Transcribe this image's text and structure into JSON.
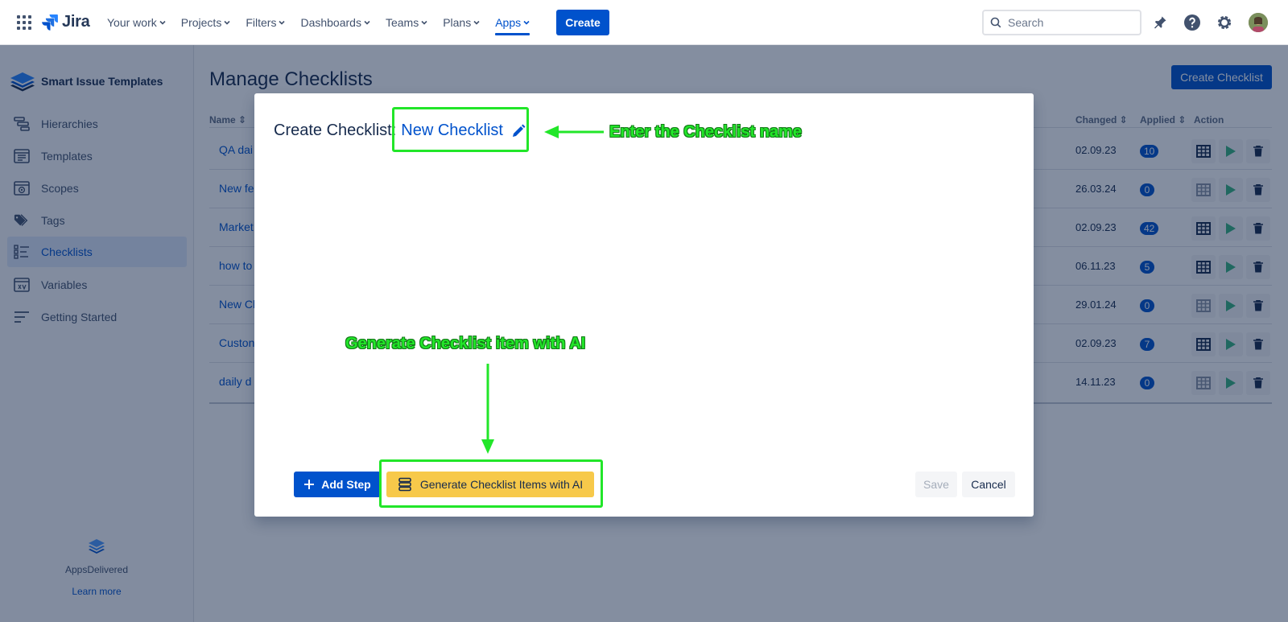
{
  "topnav": {
    "logo": "Jira",
    "items": [
      {
        "label": "Your work"
      },
      {
        "label": "Projects"
      },
      {
        "label": "Filters"
      },
      {
        "label": "Dashboards"
      },
      {
        "label": "Teams"
      },
      {
        "label": "Plans"
      },
      {
        "label": "Apps"
      }
    ],
    "create_label": "Create",
    "search_placeholder": "Search"
  },
  "sidebar": {
    "app_name": "Smart Issue Templates",
    "items": [
      {
        "label": "Hierarchies"
      },
      {
        "label": "Templates"
      },
      {
        "label": "Scopes"
      },
      {
        "label": "Tags"
      },
      {
        "label": "Checklists"
      },
      {
        "label": "Variables"
      },
      {
        "label": "Getting Started"
      }
    ],
    "footer_brand": "AppsDelivered",
    "footer_link": "Learn more"
  },
  "main": {
    "title": "Manage Checklists",
    "create_button": "Create Checklist",
    "headers": {
      "name": "Name",
      "changed": "Changed",
      "applied": "Applied",
      "action": "Action"
    },
    "rows": [
      {
        "name": "QA dai",
        "changed": "02.09.23",
        "applied": "10"
      },
      {
        "name": "New fe",
        "changed": "26.03.24",
        "applied": "0"
      },
      {
        "name": "Market",
        "changed": "02.09.23",
        "applied": "42"
      },
      {
        "name": "how to",
        "changed": "06.11.23",
        "applied": "5"
      },
      {
        "name": "New Cl",
        "changed": "29.01.24",
        "applied": "0"
      },
      {
        "name": "Custon",
        "changed": "02.09.23",
        "applied": "7"
      },
      {
        "name": "daily d",
        "changed": "14.11.23",
        "applied": "0"
      }
    ]
  },
  "modal": {
    "title_prefix": "Create Checklist:",
    "checklist_name": "New Checklist",
    "add_step": "Add Step",
    "generate_ai": "Generate Checklist Items with AI",
    "save": "Save",
    "cancel": "Cancel"
  },
  "annotations": {
    "name_hint": "Enter the Checklist name",
    "ai_hint": "Generate Checklist item with AI",
    "color": "#22e629"
  }
}
